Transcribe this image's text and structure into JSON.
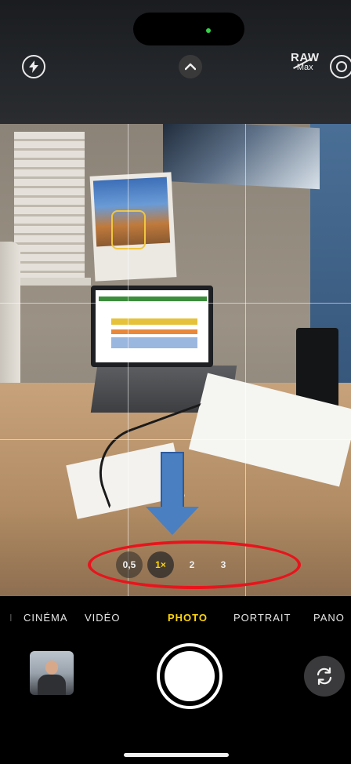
{
  "top_bar": {
    "raw_label": "RAW",
    "raw_sub": "Max",
    "icons": [
      "flash-off-icon",
      "chevron-up-icon",
      "live-photo-icon"
    ]
  },
  "zoom": {
    "options": [
      "0,5",
      "1×",
      "2",
      "3"
    ],
    "selected": "1×"
  },
  "modes": {
    "items": [
      "CINÉMA",
      "VIDÉO",
      "PHOTO",
      "PORTRAIT",
      "PANO"
    ],
    "active": "PHOTO"
  },
  "colors": {
    "accent": "#ffd60a",
    "annotation_circle": "#e8141c",
    "annotation_arrow": "#4a7fc1"
  }
}
